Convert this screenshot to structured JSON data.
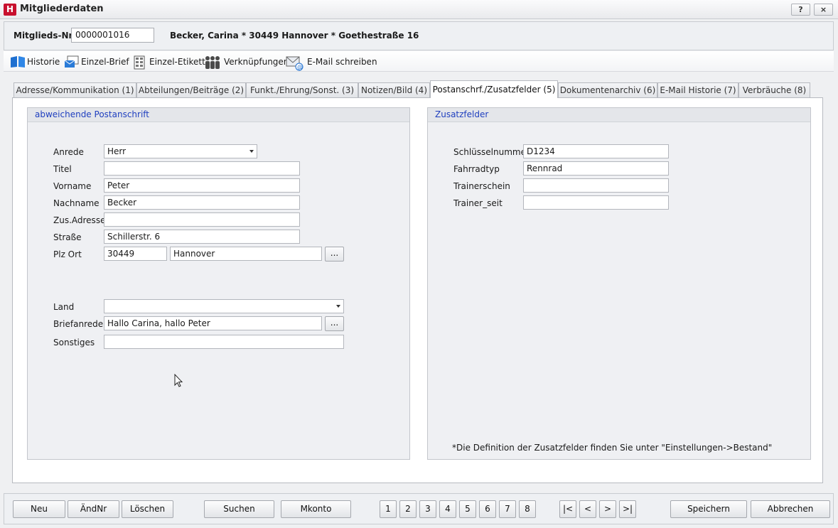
{
  "window": {
    "title": "Mitgliederdaten",
    "help_label": "?",
    "close_label": "×"
  },
  "header": {
    "member_no_label": "Mitglieds-Nr.",
    "member_no_value": "0000001016",
    "member_info": "Becker, Carina * 30449 Hannover * Goethestraße 16"
  },
  "toolbar": {
    "items": [
      {
        "label": "Historie",
        "icon": "book-icon"
      },
      {
        "label": "Einzel-Brief",
        "icon": "letter-icon"
      },
      {
        "label": "Einzel-Etikett",
        "icon": "label-sheet-icon"
      },
      {
        "label": "Verknüpfungen",
        "icon": "people-icon"
      },
      {
        "label": "E-Mail schreiben",
        "icon": "email-icon"
      }
    ]
  },
  "tabs": [
    {
      "label": "Adresse/Kommunikation (1)"
    },
    {
      "label": "Abteilungen/Beiträge (2)"
    },
    {
      "label": "Funkt./Ehrung/Sonst. (3)"
    },
    {
      "label": "Notizen/Bild (4)"
    },
    {
      "label": "Postanschrf./Zusatzfelder (5)",
      "active": true
    },
    {
      "label": "Dokumentenarchiv (6)"
    },
    {
      "label": "E-Mail Historie (7)"
    },
    {
      "label": "Verbräuche (8)"
    }
  ],
  "postal": {
    "heading": "abweichende Postanschrift",
    "anrede_label": "Anrede",
    "anrede_value": "Herr",
    "titel_label": "Titel",
    "titel_value": "",
    "vorname_label": "Vorname",
    "vorname_value": "Peter",
    "nachname_label": "Nachname",
    "nachname_value": "Becker",
    "zusadresse_label": "Zus.Adresse",
    "zusadresse_value": "",
    "strasse_label": "Straße",
    "strasse_value": "Schillerstr. 6",
    "plzort_label": "Plz Ort",
    "plz_value": "30449",
    "ort_value": "Hannover",
    "land_label": "Land",
    "land_value": "",
    "briefanrede_label": "Briefanrede",
    "briefanrede_value": "Hallo Carina, hallo Peter",
    "sonstiges_label": "Sonstiges",
    "sonstiges_value": "",
    "ellipsis": "..."
  },
  "extra": {
    "heading": "Zusatzfelder",
    "fields": [
      {
        "label": "Schlüsselnummer",
        "value": "D1234"
      },
      {
        "label": "Fahrradtyp",
        "value": "Rennrad"
      },
      {
        "label": "Trainerschein",
        "value": ""
      },
      {
        "label": "Trainer_seit",
        "value": ""
      }
    ],
    "note": "*Die Definition der Zusatzfelder finden Sie unter \"Einstellungen->Bestand\""
  },
  "bottom": {
    "neu": "Neu",
    "aendnr": "ÄndNr",
    "loeschen": "Löschen",
    "suchen": "Suchen",
    "mkonto": "Mkonto",
    "pages": [
      "1",
      "2",
      "3",
      "4",
      "5",
      "6",
      "7",
      "8"
    ],
    "first": "|<",
    "prev": "<",
    "next": ">",
    "last": ">|",
    "speichern": "Speichern",
    "abbrechen": "Abbrechen"
  }
}
